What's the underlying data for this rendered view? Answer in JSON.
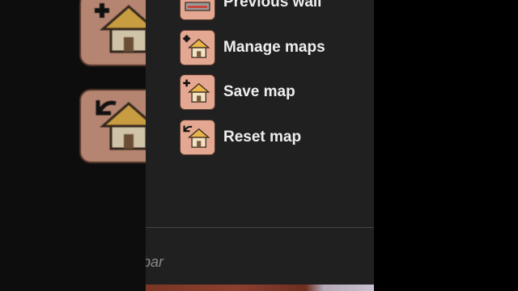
{
  "menu": {
    "items": [
      {
        "label": "Previous wall",
        "icon": "previous-wall-icon"
      },
      {
        "label": "Manage maps",
        "icon": "manage-maps-icon"
      },
      {
        "label": "Save map",
        "icon": "save-map-icon"
      },
      {
        "label": "Reset map",
        "icon": "reset-map-icon"
      }
    ]
  },
  "search": {
    "visible_text": "bar"
  },
  "colors": {
    "panel_bg": "#202020",
    "icon_bg": "#e4a892",
    "text": "#eeeeee",
    "muted_text": "#8a8a8a"
  }
}
